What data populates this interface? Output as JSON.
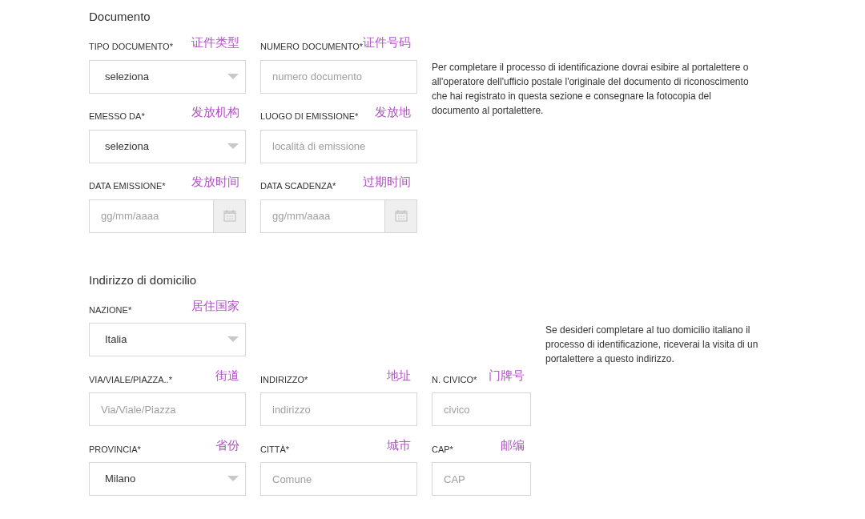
{
  "sections": [
    {
      "title": "Documento",
      "info": "Per completare il processo di identificazione dovrai esibire al portalettere o all'operatore dell'ufficio postale l'originale del documento di riconoscimento che hai registrato in questa sezione e consegnare la fotocopia del documento al portalettere.",
      "rows": [
        [
          {
            "label": "TIPO DOCUMENTO*",
            "annotation": "证件类型",
            "kind": "select",
            "value": "seleziona"
          },
          {
            "label": "NUMERO DOCUMENTO*",
            "annotation": "证件号码",
            "kind": "text",
            "placeholder": "numero documento"
          }
        ],
        [
          {
            "label": "EMESSO DA*",
            "annotation": "发放机构",
            "kind": "select",
            "value": "seleziona"
          },
          {
            "label": "LUOGO DI EMISSIONE*",
            "annotation": "发放地",
            "kind": "text",
            "placeholder": "località di emissione"
          }
        ],
        [
          {
            "label": "DATA EMISSIONE*",
            "annotation": "发放时间",
            "kind": "date",
            "placeholder": "gg/mm/aaaa"
          },
          {
            "label": "DATA SCADENZA*",
            "annotation": "过期时间",
            "kind": "date",
            "placeholder": "gg/mm/aaaa"
          }
        ]
      ]
    },
    {
      "title": "Indirizzo di domicilio",
      "info": "Se desideri completare al tuo domicilio italiano il processo di identificazione, riceverai la visita di un portalettere a questo indirizzo.",
      "rows": [
        [
          {
            "label": "NAZIONE*",
            "annotation": "居住国家",
            "kind": "select",
            "value": "Italia"
          }
        ],
        [
          {
            "label": "VIA/VIALE/PIAZZA..*",
            "annotation": "街道",
            "kind": "text",
            "placeholder": "Via/Viale/Piazza"
          },
          {
            "label": "INDIRIZZO*",
            "annotation": "地址",
            "kind": "text",
            "placeholder": "indirizzo"
          },
          {
            "label": "N. CIVICO*",
            "annotation": "门牌号",
            "kind": "text",
            "placeholder": "civico"
          }
        ],
        [
          {
            "label": "PROVINCIA*",
            "annotation": "省份",
            "kind": "select",
            "value": "Milano"
          },
          {
            "label": "CITTÀ*",
            "annotation": "城市",
            "kind": "text",
            "placeholder": "Comune"
          },
          {
            "label": "CAP*",
            "annotation": "邮编",
            "kind": "text",
            "placeholder": "CAP"
          }
        ]
      ]
    }
  ]
}
